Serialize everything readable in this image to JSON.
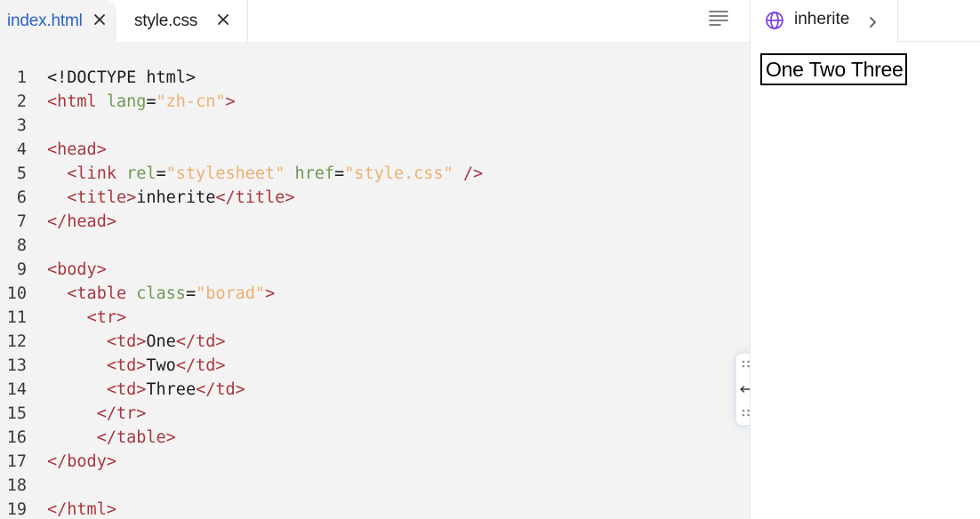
{
  "tabs": [
    {
      "label": "index.html",
      "active": true
    },
    {
      "label": "style.css",
      "active": false
    }
  ],
  "editor": {
    "lines": [
      {
        "num": "1",
        "tokens": [
          {
            "k": "text",
            "v": "<!DOCTYPE html>"
          }
        ]
      },
      {
        "num": "2",
        "tokens": [
          {
            "k": "tag",
            "v": "<html "
          },
          {
            "k": "attr",
            "v": "lang"
          },
          {
            "k": "text",
            "v": "="
          },
          {
            "k": "str",
            "v": "\"zh-cn\""
          },
          {
            "k": "tag",
            "v": ">"
          }
        ]
      },
      {
        "num": "3",
        "tokens": []
      },
      {
        "num": "4",
        "tokens": [
          {
            "k": "tag",
            "v": "<head>"
          }
        ]
      },
      {
        "num": "5",
        "tokens": [
          {
            "k": "text",
            "v": "  "
          },
          {
            "k": "tag",
            "v": "<link "
          },
          {
            "k": "attr",
            "v": "rel"
          },
          {
            "k": "text",
            "v": "="
          },
          {
            "k": "str",
            "v": "\"stylesheet\""
          },
          {
            "k": "text",
            "v": " "
          },
          {
            "k": "attr",
            "v": "href"
          },
          {
            "k": "text",
            "v": "="
          },
          {
            "k": "str",
            "v": "\"style.css\""
          },
          {
            "k": "tag",
            "v": " />"
          }
        ]
      },
      {
        "num": "6",
        "tokens": [
          {
            "k": "text",
            "v": "  "
          },
          {
            "k": "tag",
            "v": "<title>"
          },
          {
            "k": "text",
            "v": "inherite"
          },
          {
            "k": "tag",
            "v": "</title>"
          }
        ]
      },
      {
        "num": "7",
        "tokens": [
          {
            "k": "tag",
            "v": "</head>"
          }
        ]
      },
      {
        "num": "8",
        "tokens": []
      },
      {
        "num": "9",
        "tokens": [
          {
            "k": "tag",
            "v": "<body>"
          }
        ]
      },
      {
        "num": "10",
        "tokens": [
          {
            "k": "text",
            "v": "  "
          },
          {
            "k": "tag",
            "v": "<table "
          },
          {
            "k": "attr",
            "v": "class"
          },
          {
            "k": "text",
            "v": "="
          },
          {
            "k": "str",
            "v": "\"borad\""
          },
          {
            "k": "tag",
            "v": ">"
          }
        ]
      },
      {
        "num": "11",
        "tokens": [
          {
            "k": "text",
            "v": "    "
          },
          {
            "k": "tag",
            "v": "<tr>"
          }
        ]
      },
      {
        "num": "12",
        "tokens": [
          {
            "k": "text",
            "v": "      "
          },
          {
            "k": "tag",
            "v": "<td>"
          },
          {
            "k": "text",
            "v": "One"
          },
          {
            "k": "tag",
            "v": "</td>"
          }
        ]
      },
      {
        "num": "13",
        "tokens": [
          {
            "k": "text",
            "v": "      "
          },
          {
            "k": "tag",
            "v": "<td>"
          },
          {
            "k": "text",
            "v": "Two"
          },
          {
            "k": "tag",
            "v": "</td>"
          }
        ]
      },
      {
        "num": "14",
        "tokens": [
          {
            "k": "text",
            "v": "      "
          },
          {
            "k": "tag",
            "v": "<td>"
          },
          {
            "k": "text",
            "v": "Three"
          },
          {
            "k": "tag",
            "v": "</td>"
          }
        ]
      },
      {
        "num": "15",
        "tokens": [
          {
            "k": "text",
            "v": "     "
          },
          {
            "k": "tag",
            "v": "</tr>"
          }
        ]
      },
      {
        "num": "16",
        "tokens": [
          {
            "k": "text",
            "v": "     "
          },
          {
            "k": "tag",
            "v": "</table>"
          }
        ]
      },
      {
        "num": "17",
        "tokens": [
          {
            "k": "tag",
            "v": "</body>"
          }
        ]
      },
      {
        "num": "18",
        "tokens": []
      },
      {
        "num": "19",
        "tokens": [
          {
            "k": "tag",
            "v": "</html>"
          }
        ]
      }
    ]
  },
  "preview": {
    "title": "inherite",
    "cells": [
      "One",
      "Two",
      "Three"
    ]
  },
  "icons": {
    "tab_close": "close-icon",
    "menu": "menu-lines-icon",
    "globe": "globe-icon",
    "chevron": "chevron-right-icon",
    "splitter": "resize-horizontal-icon"
  },
  "colors": {
    "active_tab_text": "#2a62c4",
    "tag": "#a8373d",
    "attribute": "#6f9a52",
    "string": "#edb06f",
    "globe": "#7b3fe4"
  }
}
